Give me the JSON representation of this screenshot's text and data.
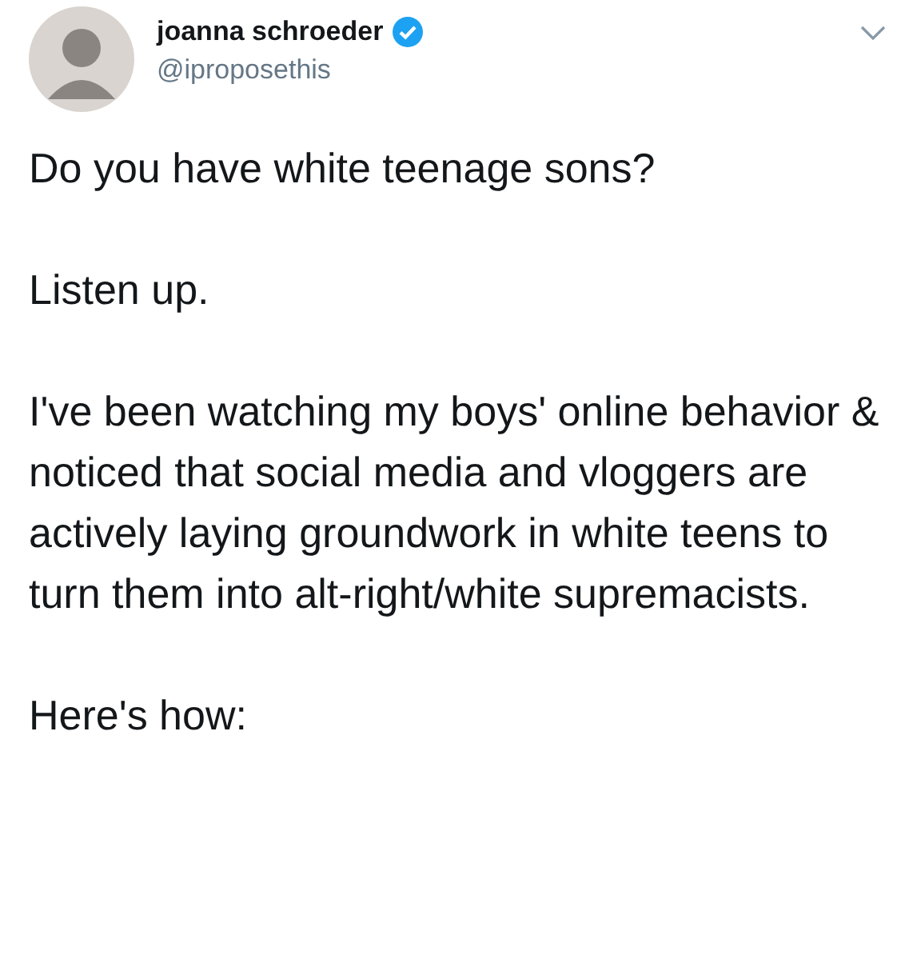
{
  "tweet": {
    "author": {
      "name": "joanna schroeder",
      "verified": true,
      "handle": "@iproposethis"
    },
    "paragraphs": [
      "Do you have white teenage sons?",
      "Listen up.",
      "I've been watching my boys' online behavior & noticed that social media and vloggers are actively laying groundwork in white teens to turn them into alt-right/white supremacists.",
      "Here's how:"
    ]
  }
}
